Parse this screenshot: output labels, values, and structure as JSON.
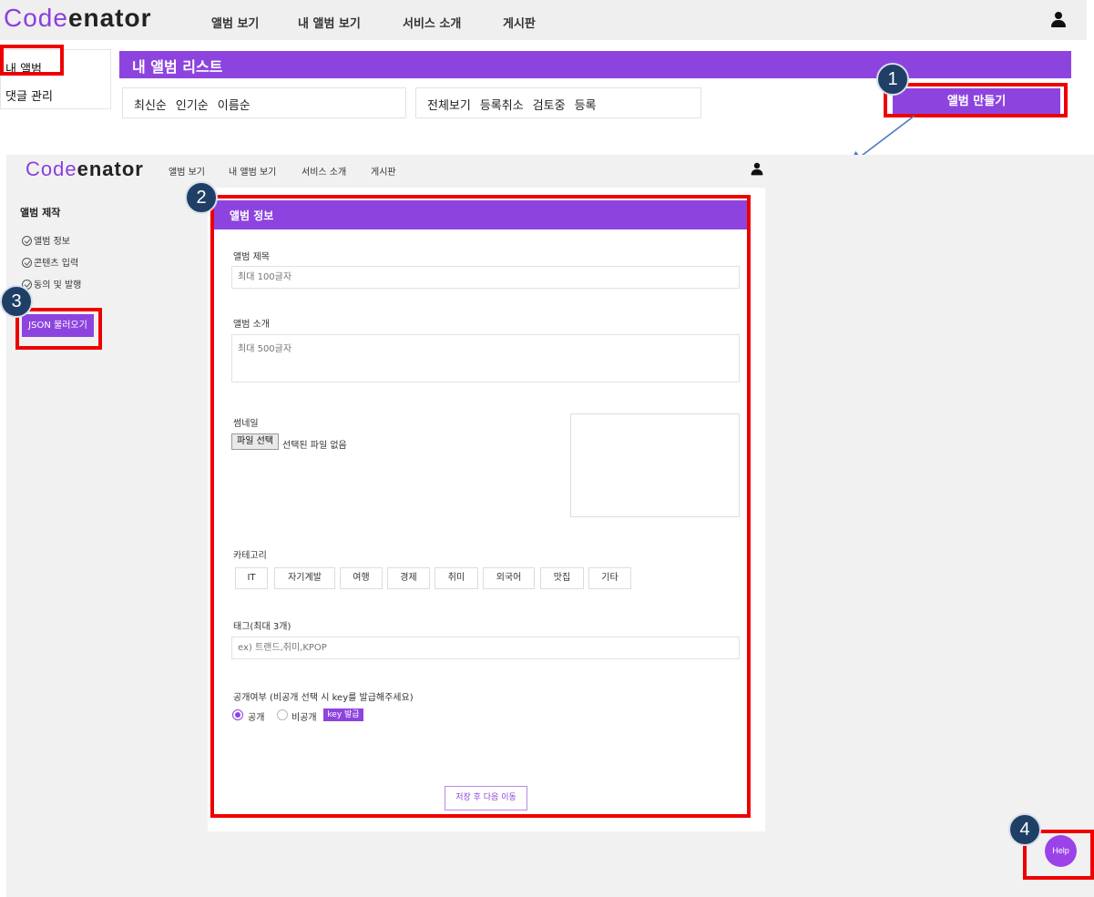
{
  "top": {
    "logo_code": "Code",
    "logo_rest": "enator",
    "nav": [
      "앨범 보기",
      "내 앨범 보기",
      "서비스 소개",
      "게시판"
    ],
    "sidebar": [
      "내 앨범",
      "댓글 관리"
    ],
    "list_title": "내 앨범 리스트",
    "sort_filters": [
      "최신순",
      "인기순",
      "이름순"
    ],
    "status_filters": [
      "전체보기",
      "등록취소",
      "검토중",
      "등록"
    ],
    "create_button": "앨범 만들기"
  },
  "bottom": {
    "logo_code": "Code",
    "logo_rest": "enator",
    "nav": [
      "앨범 보기",
      "내 앨범 보기",
      "서비스 소개",
      "게시판"
    ],
    "sidebar_title": "앨범 제작",
    "steps": [
      "앨범 정보",
      "콘텐츠 입력",
      "동의 및 발행"
    ],
    "json_button": "JSON 불러오기",
    "form_header": "앨범 정보",
    "title_label": "앨범 제목",
    "title_placeholder": "최대 100글자",
    "intro_label": "앨범 소개",
    "intro_placeholder": "최대 500글자",
    "thumbnail_label": "썸네일",
    "file_button": "파일 선택",
    "file_status": "선택된 파일 없음",
    "category_label": "카테고리",
    "categories": [
      "IT",
      "자기계발",
      "여행",
      "경제",
      "취미",
      "외국어",
      "맛집",
      "기타"
    ],
    "tag_label": "태그(최대 3개)",
    "tag_placeholder": "ex) 트랜드,취미,KPOP",
    "visibility_label": "공개여부 (비공개 선택 시 key를 발급해주세요)",
    "public_option": "공개",
    "private_option": "비공개",
    "key_button": "key 발급",
    "save_button": "저장 후 다음 이동",
    "help_button": "Help"
  },
  "annotations": [
    "1",
    "2",
    "3",
    "4"
  ],
  "colors": {
    "brand_purple": "#8d44df",
    "highlight_red": "#ee0000",
    "badge_navy": "#1f3f66"
  }
}
